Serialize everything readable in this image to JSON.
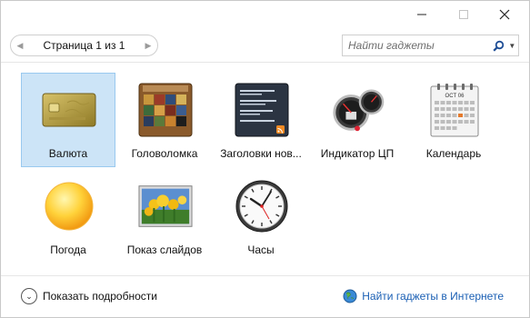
{
  "pager": {
    "text": "Страница 1 из 1",
    "prev_icon": "chevron-left-icon",
    "next_icon": "chevron-right-icon"
  },
  "search": {
    "placeholder": "Найти гаджеты",
    "icon": "search-icon",
    "dropdown_icon": "dropdown-arrow-icon"
  },
  "gadgets": [
    {
      "label": "Валюта",
      "icon": "currency-gadget-icon",
      "selected": true
    },
    {
      "label": "Головоломка",
      "icon": "puzzle-gadget-icon",
      "selected": false
    },
    {
      "label": "Заголовки нов...",
      "icon": "news-headlines-gadget-icon",
      "selected": false
    },
    {
      "label": "Индикатор ЦП",
      "icon": "cpu-meter-gadget-icon",
      "selected": false
    },
    {
      "label": "Календарь",
      "icon": "calendar-gadget-icon",
      "selected": false
    },
    {
      "label": "Погода",
      "icon": "weather-gadget-icon",
      "selected": false
    },
    {
      "label": "Показ слайдов",
      "icon": "slideshow-gadget-icon",
      "selected": false
    },
    {
      "label": "Часы",
      "icon": "clock-gadget-icon",
      "selected": false
    }
  ],
  "calendar_thumb": {
    "month": "OCT 06"
  },
  "footer": {
    "details_label": "Показать подробности",
    "online_link": "Найти гаджеты в Интернете"
  },
  "colors": {
    "selection_bg": "#cce4f7",
    "selection_border": "#99c9ef",
    "link": "#1a5fb4"
  }
}
